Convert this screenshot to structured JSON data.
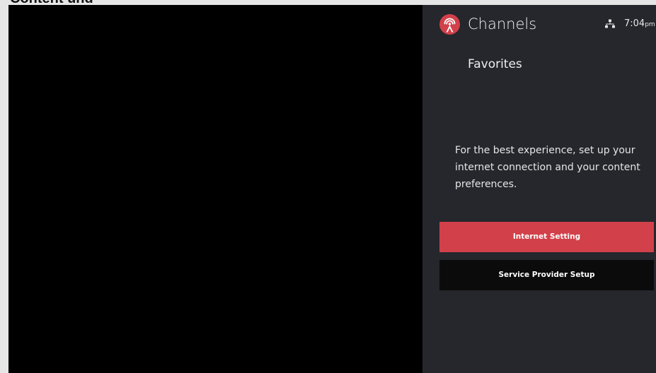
{
  "overlay": {
    "clipped_text": "Content und"
  },
  "header": {
    "app_title": "Channels",
    "logo_icon": "channels-broadcast-logo",
    "network_icon": "network-icon",
    "time": "7:04",
    "time_suffix": "pm"
  },
  "section": {
    "title": "Favorites"
  },
  "message": {
    "text": "For the best experience, set up your internet connection and your content preferences."
  },
  "buttons": {
    "internet_setting": "Internet Setting",
    "service_provider_setup": "Service Provider Setup"
  },
  "colors": {
    "panel_background": "#25272c",
    "accent_red": "#d2404a",
    "dark_button": "#0b0b0c",
    "video_background": "#000000"
  }
}
